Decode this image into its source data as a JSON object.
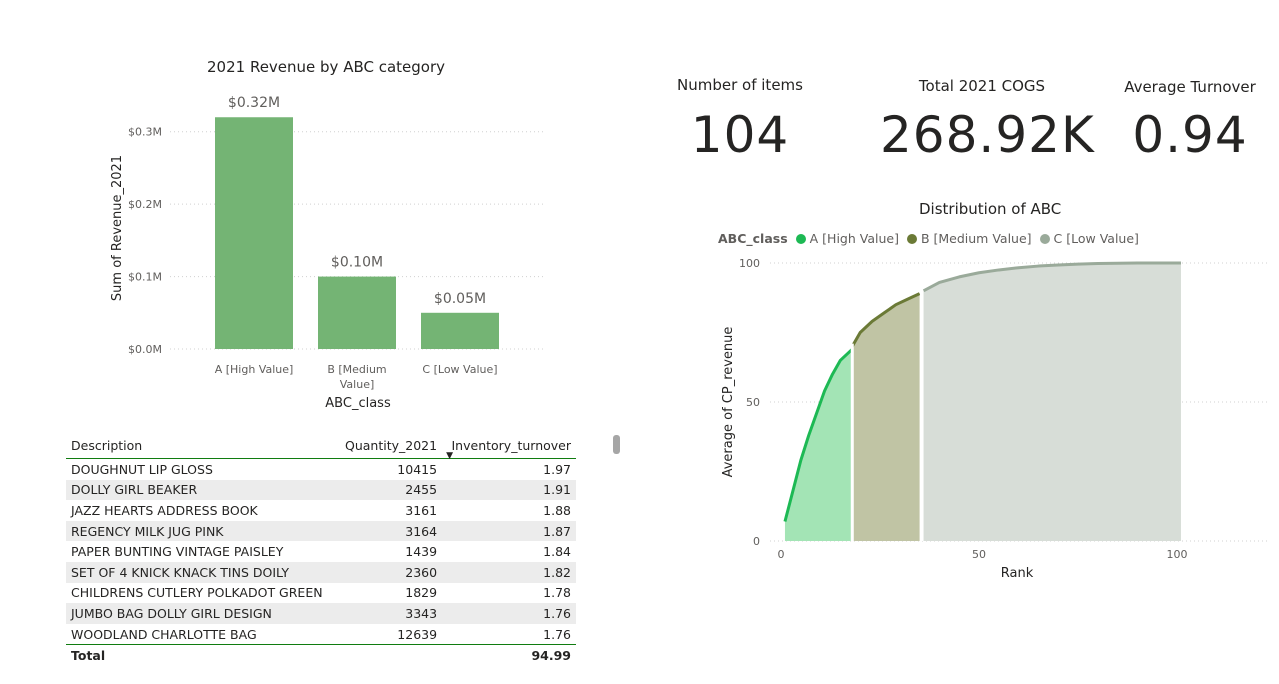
{
  "bar_chart": {
    "title": "2021 Revenue by ABC category",
    "xlabel": "ABC_class",
    "ylabel": "Sum of Revenue_2021",
    "y_ticks": [
      "$0.0M",
      "$0.1M",
      "$0.2M",
      "$0.3M"
    ],
    "cat_lines": [
      [
        "A [High Value]"
      ],
      [
        "B [Medium",
        "Value]"
      ],
      [
        "C [Low Value]"
      ]
    ],
    "data_labels": [
      "$0.32M",
      "$0.10M",
      "$0.05M"
    ],
    "bar_color": "#74b474"
  },
  "kpis": [
    {
      "label": "Number of items",
      "value": "104"
    },
    {
      "label": "Total 2021 COGS",
      "value": "268.92K"
    },
    {
      "label": "Average Turnover",
      "value": "0.94"
    }
  ],
  "table": {
    "headers": [
      "Description",
      "Quantity_2021",
      "Inventory_turnover"
    ],
    "rows": [
      [
        "DOUGHNUT LIP GLOSS",
        "10415",
        "1.97"
      ],
      [
        "DOLLY GIRL BEAKER",
        "2455",
        "1.91"
      ],
      [
        "JAZZ HEARTS ADDRESS BOOK",
        "3161",
        "1.88"
      ],
      [
        "REGENCY MILK JUG PINK",
        "3164",
        "1.87"
      ],
      [
        "PAPER BUNTING VINTAGE PAISLEY",
        "1439",
        "1.84"
      ],
      [
        "SET OF 4 KNICK KNACK TINS DOILY",
        "2360",
        "1.82"
      ],
      [
        "CHILDRENS CUTLERY POLKADOT GREEN",
        "1829",
        "1.78"
      ],
      [
        "JUMBO BAG DOLLY GIRL DESIGN",
        "3343",
        "1.76"
      ],
      [
        "WOODLAND CHARLOTTE BAG",
        "12639",
        "1.76"
      ]
    ],
    "total": {
      "label": "Total",
      "quantity": "",
      "turnover": "94.99"
    },
    "sort_icon": "sort-descending-icon"
  },
  "area_chart": {
    "title": "Distribution of ABC",
    "legend_title": "ABC_class",
    "legend": [
      {
        "label": "A [High Value]",
        "color": "#1db954"
      },
      {
        "label": "B [Medium Value]",
        "color": "#6b7a36"
      },
      {
        "label": "C [Low Value]",
        "color": "#9aaa9a"
      }
    ],
    "xlabel": "Rank",
    "ylabel": "Average of CP_revenue",
    "x_ticks": [
      "0",
      "50",
      "100"
    ],
    "y_ticks": [
      "0",
      "50",
      "100"
    ]
  },
  "chart_data": [
    {
      "type": "bar",
      "title": "2021 Revenue by ABC category",
      "categories": [
        "A [High Value]",
        "B [Medium Value]",
        "C [Low Value]"
      ],
      "values": [
        0.32,
        0.1,
        0.05
      ],
      "unit": "$M",
      "xlabel": "ABC_class",
      "ylabel": "Sum of Revenue_2021",
      "ylim": [
        0,
        0.33
      ]
    },
    {
      "type": "area",
      "title": "Distribution of ABC",
      "xlabel": "Rank",
      "ylabel": "Average of CP_revenue",
      "xlim": [
        0,
        101
      ],
      "ylim": [
        0,
        100
      ],
      "series": [
        {
          "name": "A [High Value]",
          "x": [
            1,
            3,
            5,
            7,
            9,
            11,
            13,
            15,
            18
          ],
          "y": [
            7,
            18,
            29,
            38,
            46,
            54,
            60,
            65,
            69
          ]
        },
        {
          "name": "B [Medium Value]",
          "x": [
            18,
            20,
            23,
            26,
            29,
            32,
            35
          ],
          "y": [
            70,
            75,
            79,
            82,
            85,
            87,
            89
          ]
        },
        {
          "name": "C [Low Value]",
          "x": [
            36,
            40,
            45,
            50,
            55,
            60,
            65,
            70,
            75,
            80,
            85,
            90,
            95,
            101
          ],
          "y": [
            90,
            93,
            95,
            96.5,
            97.5,
            98.3,
            98.9,
            99.3,
            99.6,
            99.8,
            99.9,
            100,
            100,
            100
          ]
        }
      ]
    }
  ]
}
